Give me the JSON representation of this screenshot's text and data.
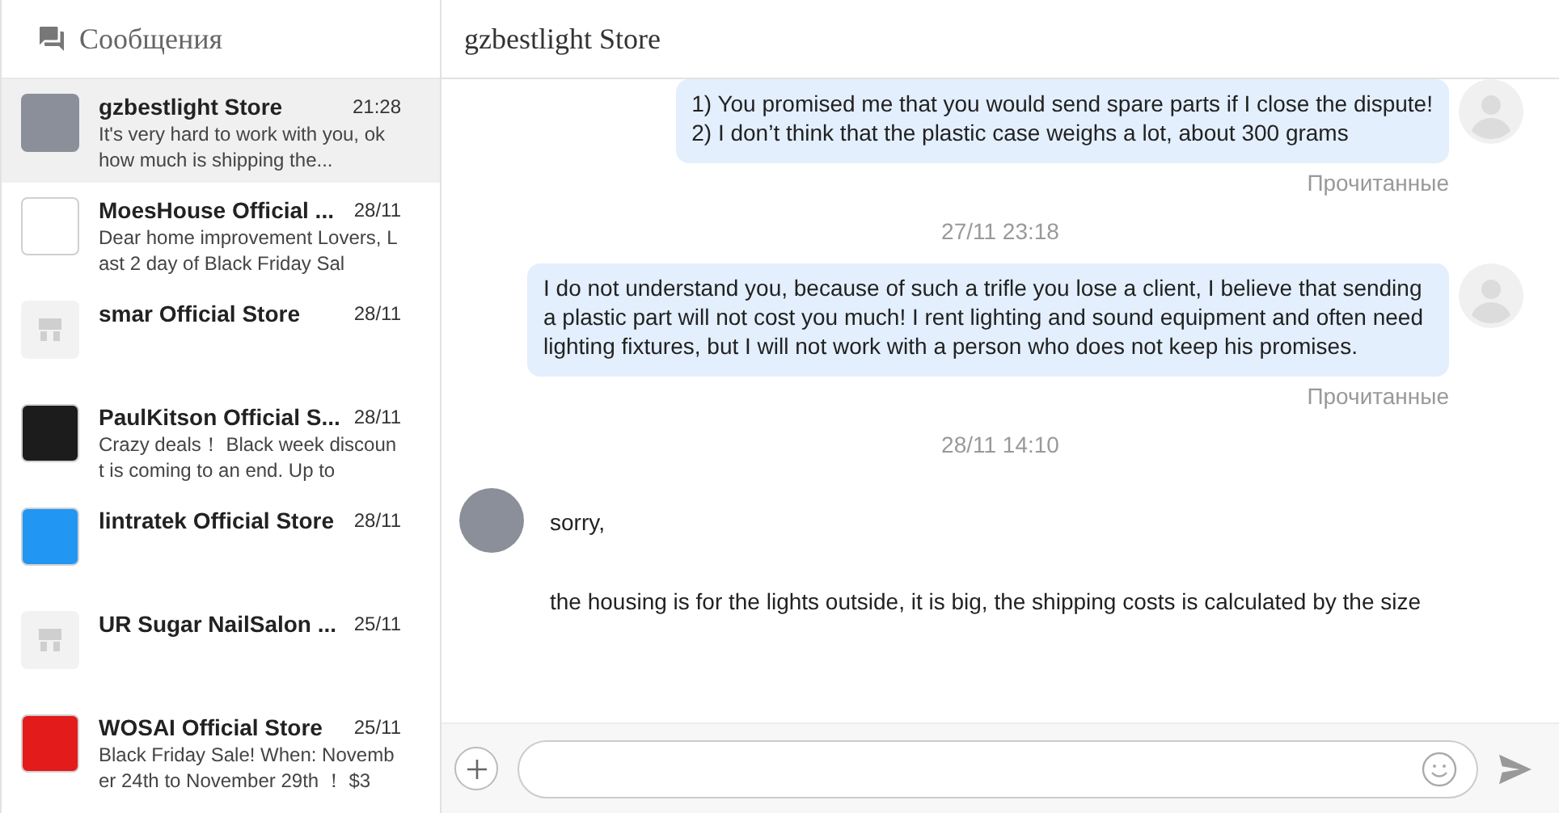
{
  "sidebar": {
    "title": "Сообщения",
    "conversations": [
      {
        "name": "gzbestlight Store",
        "time": "21:28",
        "preview": "It's very hard to work with you, ok how much is shipping the...",
        "kind": "person",
        "selected": true
      },
      {
        "name": "MoesHouse Official ...",
        "time": "28/11",
        "preview": "Dear home improvement Lovers, Last 2 day of Black Friday Sal",
        "kind": "logo",
        "color": "#ffffff",
        "selected": false
      },
      {
        "name": "smar Official Store",
        "time": "28/11",
        "kind": "store",
        "selected": false
      },
      {
        "name": "PaulKitson Official S...",
        "time": "28/11",
        "preview": "Crazy deals！ Black week discount is coming to an end. Up to",
        "kind": "logo",
        "color": "#1c1c1c",
        "selected": false
      },
      {
        "name": "lintratek Official Store",
        "time": "28/11",
        "kind": "logo",
        "color": "#2196f3",
        "selected": false
      },
      {
        "name": "UR Sugar NailSalon ...",
        "time": "25/11",
        "kind": "store",
        "selected": false
      },
      {
        "name": "WOSAI Official Store",
        "time": "25/11",
        "preview": "Black Friday Sale! When: November 24th to November 29th ！ $3",
        "kind": "logo",
        "color": "#e31b1b",
        "selected": false
      }
    ]
  },
  "chat": {
    "title": "gzbestlight Store",
    "messages": [
      {
        "kind": "outgoing",
        "lines": [
          "1) You promised me that you would send spare parts if I close the dispute!",
          "2) I don’t think that the plastic case weighs a lot, about 300 grams"
        ],
        "status": "Прочитанные"
      },
      {
        "kind": "timestamp",
        "text": "27/11 23:18"
      },
      {
        "kind": "outgoing",
        "lines": [
          "I do not understand you, because of such a trifle you lose a client, I believe that sending a plastic part will not cost you much! I rent lighting and sound equipment and often need lighting fixtures, but I will not work with a person who does not keep his promises."
        ],
        "status": "Прочитанные"
      },
      {
        "kind": "timestamp",
        "text": "28/11 14:10"
      },
      {
        "kind": "incoming",
        "lines": [
          "sorry,",
          "the housing is for the lights outside, it is big, the shipping costs is calculated by the size"
        ]
      }
    ]
  }
}
